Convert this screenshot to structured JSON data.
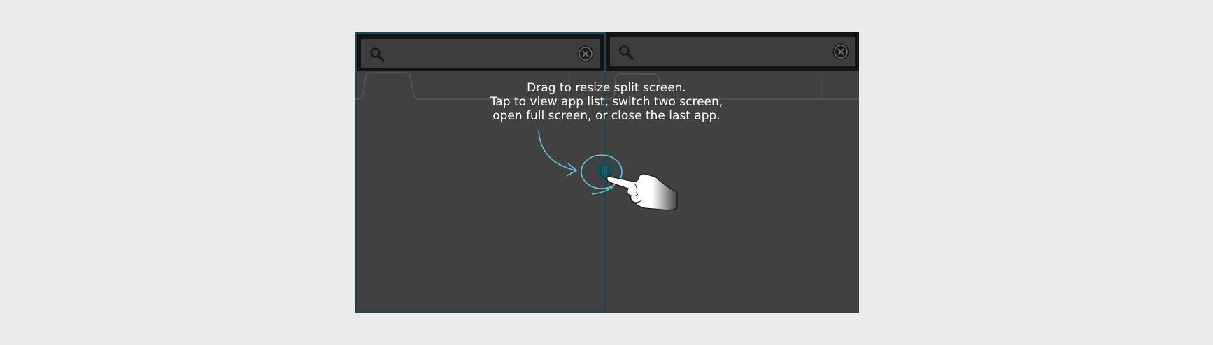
{
  "hint": {
    "line1": "Drag to resize split screen.",
    "line2": "Tap to view app list, switch two screen,",
    "line3": "open full screen, or close the last app."
  },
  "icons": {
    "search": "search-icon",
    "clear": "close-circle-icon",
    "handle": "split-handle-icon",
    "hand": "pointing-hand-icon"
  },
  "colors": {
    "background": "#ebebeb",
    "pane": "#414141",
    "search_bar": "#141414",
    "active_outline": "#1c4750",
    "guide": "#5ec8dc"
  }
}
